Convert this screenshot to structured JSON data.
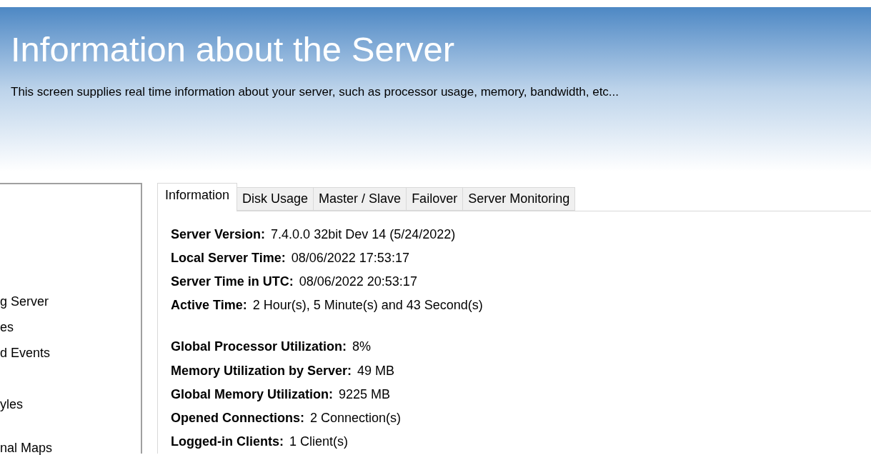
{
  "header": {
    "title": "Information about the Server",
    "subtitle": "This screen supplies real time information about your server, such as processor usage, memory, bandwidth, etc..."
  },
  "sidebar": {
    "items": [
      {
        "label": "g Server"
      },
      {
        "label": "es"
      },
      {
        "label": "d Events"
      },
      {
        "label": "yles"
      },
      {
        "label": "nal Maps"
      }
    ]
  },
  "tabs": [
    {
      "label": "Information",
      "selected": true
    },
    {
      "label": "Disk Usage",
      "selected": false
    },
    {
      "label": "Master / Slave",
      "selected": false
    },
    {
      "label": "Failover",
      "selected": false
    },
    {
      "label": "Server Monitoring",
      "selected": false
    }
  ],
  "info_groups": [
    [
      {
        "label": "Server Version:",
        "value": "7.4.0.0 32bit Dev 14 (5/24/2022)"
      },
      {
        "label": "Local Server Time:",
        "value": "08/06/2022 17:53:17"
      },
      {
        "label": "Server Time in UTC:",
        "value": "08/06/2022 20:53:17"
      },
      {
        "label": "Active Time:",
        "value": "2 Hour(s), 5 Minute(s) and 43 Second(s)"
      }
    ],
    [
      {
        "label": "Global Processor Utilization:",
        "value": "8%"
      },
      {
        "label": "Memory Utilization by Server:",
        "value": "49 MB"
      },
      {
        "label": "Global Memory Utilization:",
        "value": "9225 MB"
      },
      {
        "label": "Opened Connections:",
        "value": "2 Connection(s)"
      },
      {
        "label": "Logged-in Clients:",
        "value": "1 Client(s)"
      }
    ]
  ]
}
